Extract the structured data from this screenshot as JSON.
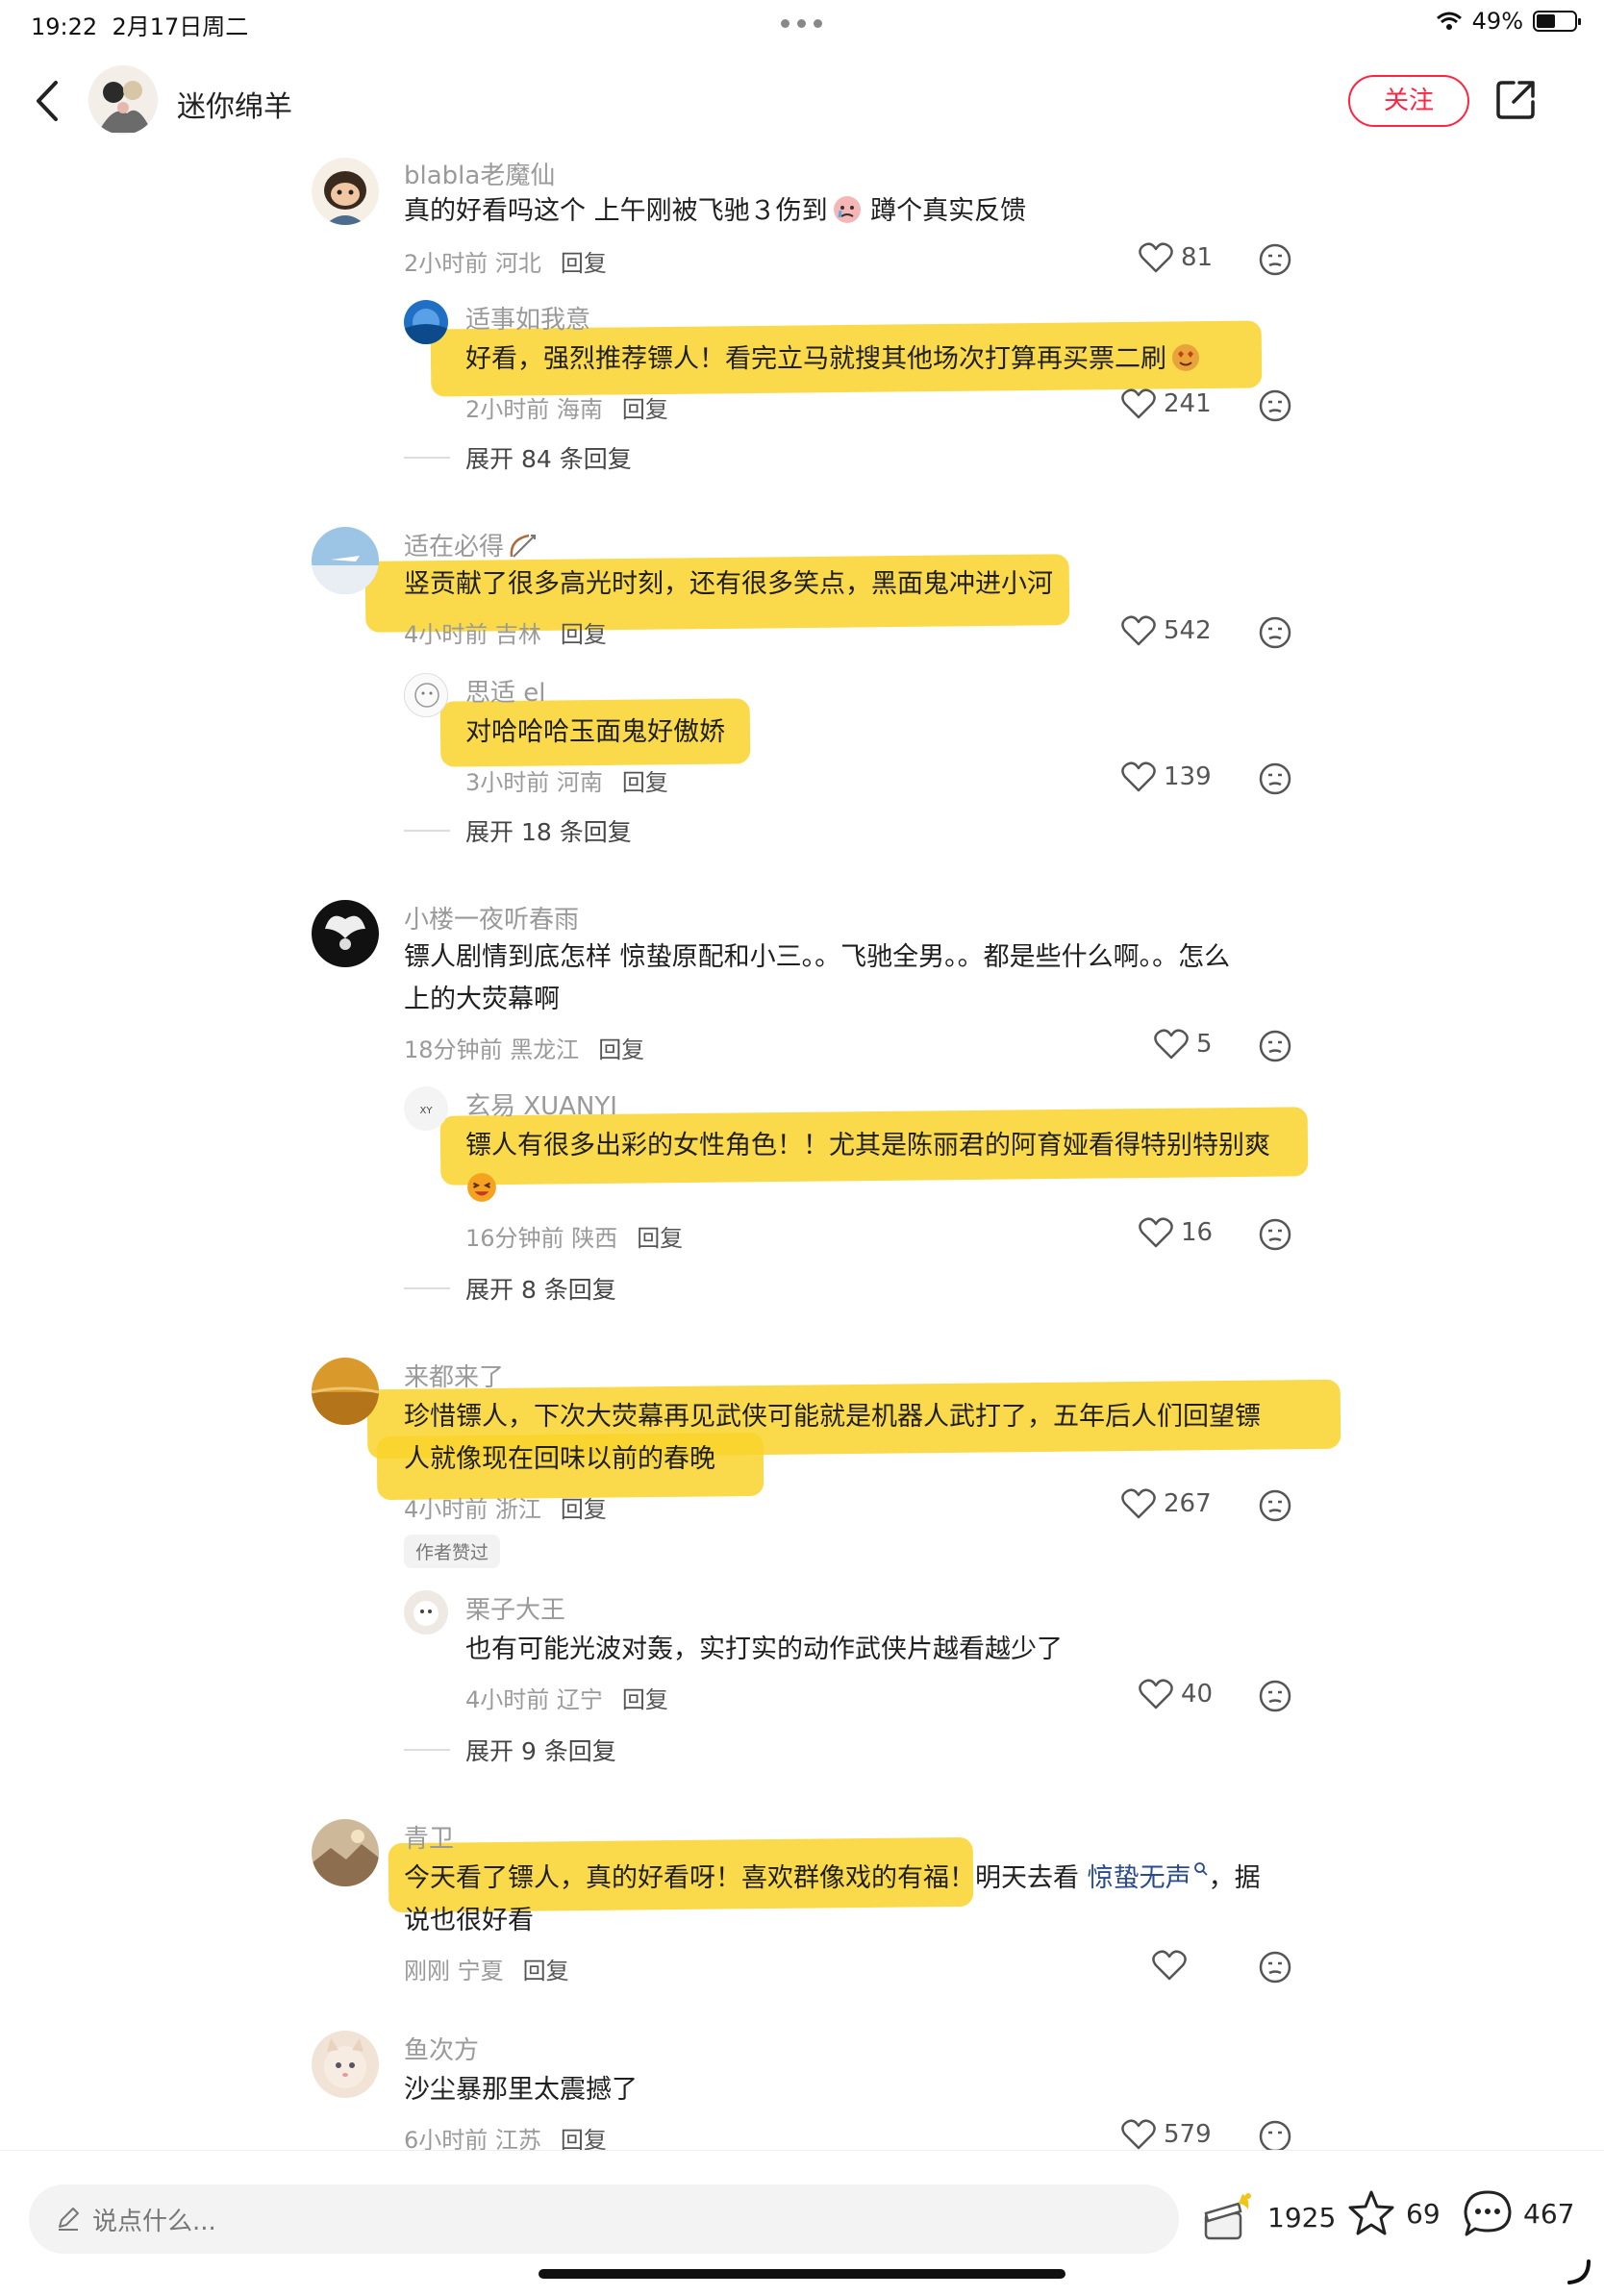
{
  "status": {
    "time": "19:22",
    "date": "2月17日周二",
    "battery": "49%",
    "battery_level": 0.49
  },
  "header": {
    "title": "迷你绵羊",
    "follow_label": "关注"
  },
  "reply_label": "回复",
  "comments": [
    {
      "name": "blabla老魔仙",
      "text": "真的好看吗这个 上午刚被飞驰３伤到",
      "text_tail": " 蹲个真实反馈",
      "time": "2小时前",
      "region": "河北",
      "likes": "81",
      "reply": {
        "name": "适事如我意",
        "text": "好看，强烈推荐镖人！看完立马就搜其他场次打算再买票二刷",
        "time": "2小时前",
        "region": "海南",
        "likes": "241"
      },
      "expand": "展开 84 条回复"
    },
    {
      "name": "适在必得",
      "text": "竖贡献了很多高光时刻，还有很多笑点，黑面鬼冲进小河",
      "time": "4小时前",
      "region": "吉林",
      "likes": "542",
      "reply": {
        "name": "思适 el",
        "text": "对哈哈哈玉面鬼好傲娇",
        "time": "3小时前",
        "region": "河南",
        "likes": "139"
      },
      "expand": "展开 18 条回复"
    },
    {
      "name": "小楼一夜听春雨",
      "text_line1": "镖人剧情到底怎样 惊蛰原配和小三。。飞驰全男。。都是些什么啊。。怎么",
      "text_line2": "上的大荧幕啊",
      "time": "18分钟前",
      "region": "黑龙江",
      "likes": "5",
      "reply": {
        "name": "玄易 XUANYI",
        "text": "镖人有很多出彩的女性角色！！尤其是陈丽君的阿育娅看得特别特别爽",
        "time": "16分钟前",
        "region": "陕西",
        "likes": "16"
      },
      "expand": "展开 8 条回复"
    },
    {
      "name": "来都来了",
      "text_line1": "珍惜镖人，下次大荧幕再见武侠可能就是机器人武打了，五年后人们回望镖",
      "text_line2": "人就像现在回味以前的春晚",
      "time": "4小时前",
      "region": "浙江",
      "likes": "267",
      "tag": "作者赞过",
      "reply": {
        "name": "栗子大王",
        "text": "也有可能光波对轰，实打实的动作武侠片越看越少了",
        "time": "4小时前",
        "region": "辽宁",
        "likes": "40"
      },
      "expand": "展开 9 条回复"
    },
    {
      "name": "青卫",
      "text_line1_a": "今天看了镖人，真的好看呀！喜欢群像戏的有福！明天去看 ",
      "text_link": "惊蛰无声",
      "text_line1_b": "，据",
      "text_line2": "说也很好看",
      "time": "刚刚",
      "region": "宁夏",
      "likes": ""
    },
    {
      "name": "鱼次方",
      "text": "沙尘暴那里太震撼了",
      "time": "6小时前",
      "region": "江苏",
      "likes": "579"
    }
  ],
  "bottom": {
    "placeholder": "说点什么...",
    "likes": "1925",
    "stars": "69",
    "comments": "467"
  }
}
